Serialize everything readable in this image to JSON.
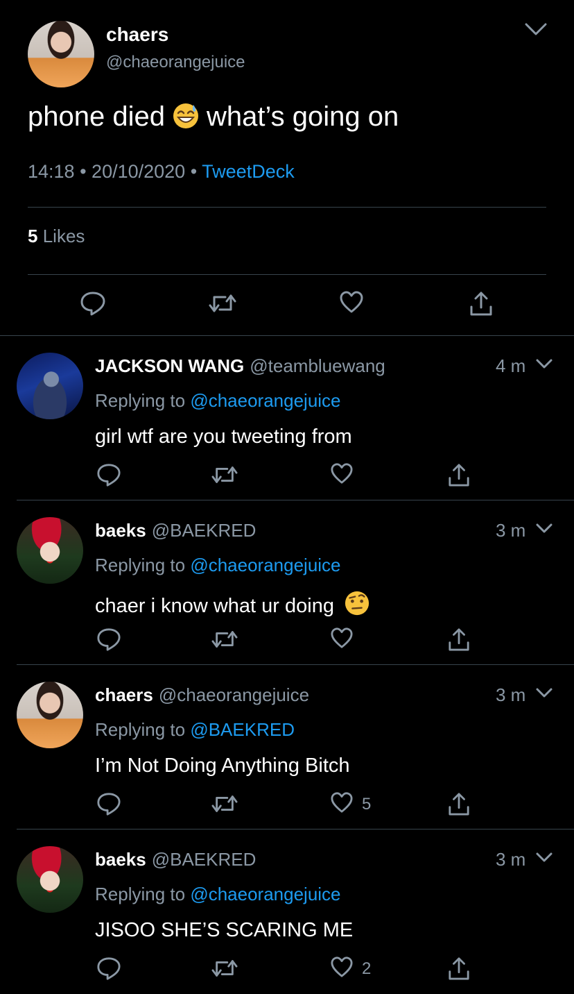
{
  "main_tweet": {
    "name": "chaers",
    "handle": "@chaeorangejuice",
    "text_before": "phone died",
    "emoji": "grinning-sweat-emoji",
    "text_after": "what’s going on",
    "time": "14:18",
    "sep1": " • ",
    "date": "20/10/2020",
    "sep2": " • ",
    "source": "TweetDeck",
    "likes_count": "5",
    "likes_label": "Likes"
  },
  "replies": [
    {
      "name": "JACKSON WANG",
      "handle": "@teambluewang",
      "time": "4 m",
      "replying_label": "Replying to",
      "replying_to": "@chaeorangejuice",
      "text": "girl wtf are you tweeting from",
      "like_count": ""
    },
    {
      "name": "baeks",
      "handle": "@BAEKRED",
      "time": "3 m",
      "replying_label": "Replying to",
      "replying_to": "@chaeorangejuice",
      "text": "chaer i know what ur doing",
      "emoji": "raised-eyebrow-emoji",
      "like_count": ""
    },
    {
      "name": "chaers",
      "handle": "@chaeorangejuice",
      "time": "3 m",
      "replying_label": "Replying to",
      "replying_to": "@BAEKRED",
      "text": "I’m Not Doing Anything Bitch",
      "like_count": "5"
    },
    {
      "name": "baeks",
      "handle": "@BAEKRED",
      "time": "3 m",
      "replying_label": "Replying to",
      "replying_to": "@chaeorangejuice",
      "text": "JISOO SHE’S SCARING ME",
      "like_count": "2"
    }
  ],
  "colors": {
    "background": "#000000",
    "link": "#1d9bf0",
    "muted": "#8b98a5",
    "divider": "#38444d"
  }
}
